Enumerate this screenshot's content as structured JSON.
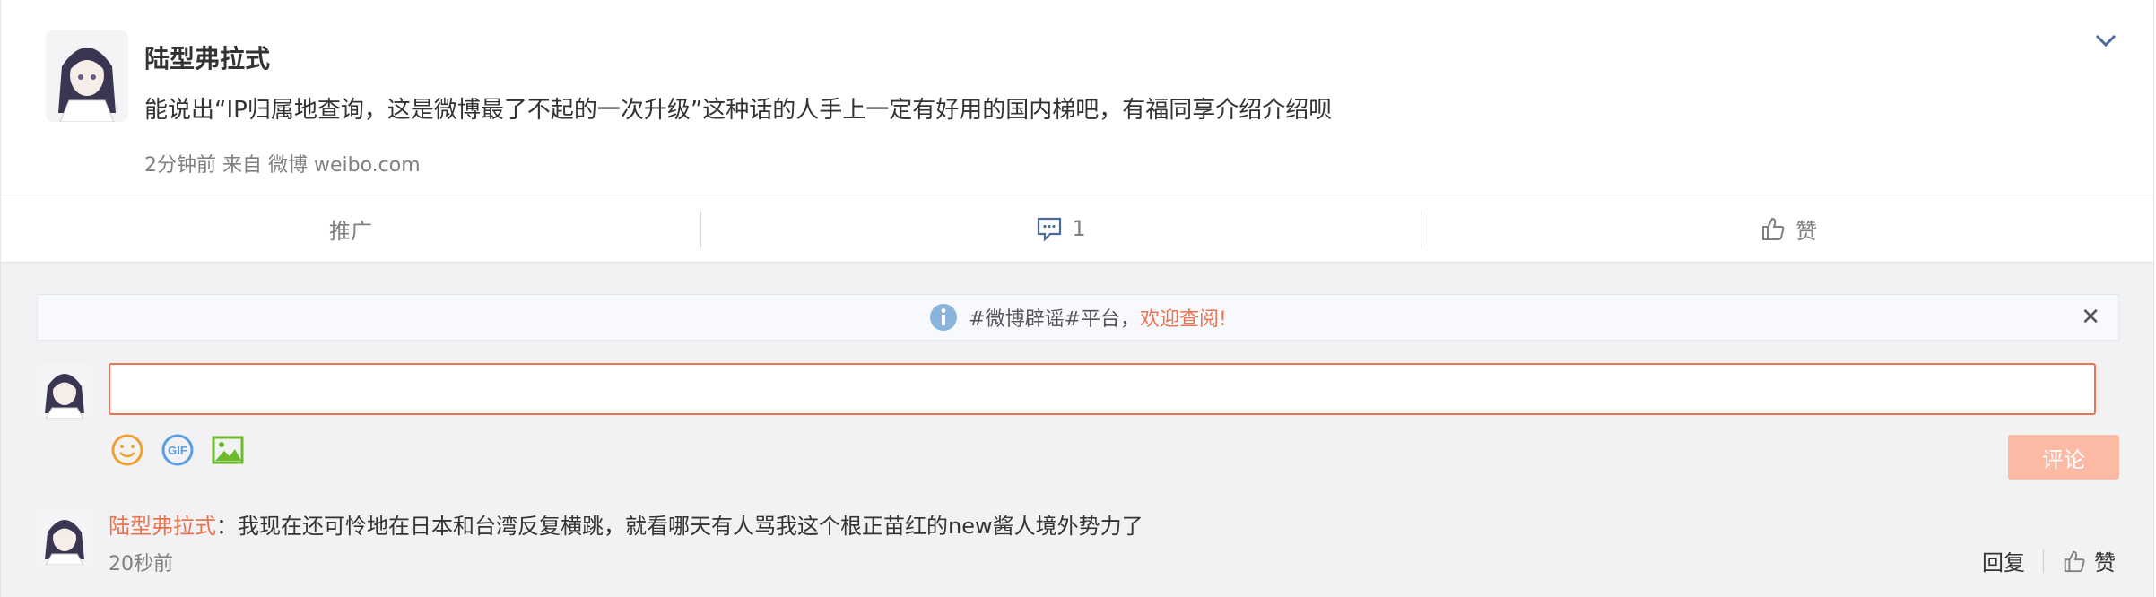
{
  "post": {
    "username": "陆型弗拉式",
    "text": "能说出“IP归属地查询，这是微博最了不起的一次升级”这种话的人手上一定有好用的国内梯吧，有福同享介绍介绍呗",
    "meta": "2分钟前 来自 微博 weibo.com"
  },
  "actions": {
    "promote_label": "推广",
    "comment_count": "1",
    "like_label": "赞"
  },
  "notice": {
    "text": "#微博辟谣#平台，",
    "link": "欢迎查阅!"
  },
  "composer": {
    "submit_label": "评论",
    "tools": [
      "emoji-icon",
      "gif-icon",
      "image-icon"
    ]
  },
  "comment": {
    "author": "陆型弗拉式",
    "colon": "：",
    "text": "我现在还可怜地在日本和台湾反复横跳，就看哪天有人骂我这个根正苗红的new酱人境外势力了",
    "time": "20秒前",
    "reply_label": "回复",
    "like_label": "赞"
  },
  "colors": {
    "accent": "#eb7350",
    "submit_disabled": "#fcb9a4",
    "comment_bg": "#f2f2f5"
  }
}
